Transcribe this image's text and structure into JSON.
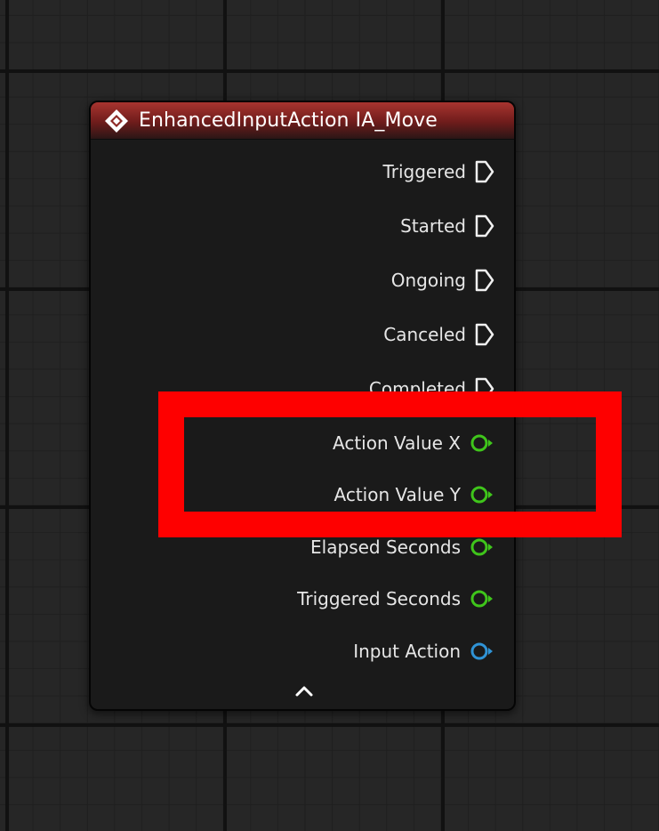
{
  "node": {
    "title": "EnhancedInputAction IA_Move",
    "header_color": "#8e2a27",
    "event_icon": "diamond-event-icon",
    "exec_outputs": [
      {
        "label": "Triggered"
      },
      {
        "label": "Started"
      },
      {
        "label": "Ongoing"
      },
      {
        "label": "Canceled"
      },
      {
        "label": "Completed"
      }
    ],
    "data_outputs": [
      {
        "label": "Action Value X",
        "pin_color": "#3fc51b"
      },
      {
        "label": "Action Value Y",
        "pin_color": "#3fc51b"
      },
      {
        "label": "Elapsed Seconds",
        "pin_color": "#3fc51b"
      },
      {
        "label": "Triggered Seconds",
        "pin_color": "#3fc51b"
      },
      {
        "label": "Input Action",
        "pin_color": "#2f93d6"
      }
    ],
    "collapse_icon": "chevron-up-icon"
  },
  "annotation": {
    "highlight_color": "#fe0000"
  }
}
